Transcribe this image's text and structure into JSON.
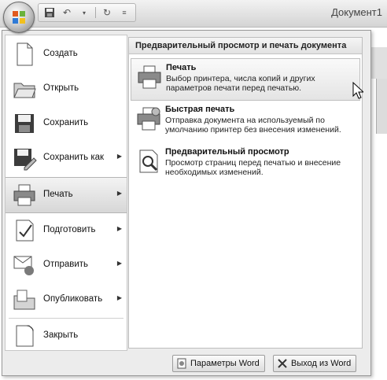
{
  "window": {
    "document_title": "Документ1"
  },
  "quick_access": {
    "save_icon": "floppy-icon",
    "undo_icon": "undo-icon",
    "redo_icon": "redo-icon",
    "customize_icon": "dropdown-icon"
  },
  "left_menu": [
    {
      "label": "Создать",
      "icon": "new-document-icon",
      "has_submenu": false
    },
    {
      "label": "Открыть",
      "icon": "open-folder-icon",
      "has_submenu": false
    },
    {
      "label": "Сохранить",
      "icon": "floppy-icon",
      "has_submenu": false
    },
    {
      "label": "Сохранить как",
      "icon": "save-as-icon",
      "has_submenu": true
    },
    {
      "label": "Печать",
      "icon": "printer-icon",
      "has_submenu": true
    },
    {
      "label": "Подготовить",
      "icon": "prepare-icon",
      "has_submenu": true
    },
    {
      "label": "Отправить",
      "icon": "send-icon",
      "has_submenu": true
    },
    {
      "label": "Опубликовать",
      "icon": "publish-icon",
      "has_submenu": true
    },
    {
      "label": "Закрыть",
      "icon": "close-document-icon",
      "has_submenu": false
    }
  ],
  "submenu": {
    "header": "Предварительный просмотр и печать документа",
    "items": [
      {
        "title": "Печать",
        "description": "Выбор принтера, числа копий и других параметров печати перед печатью."
      },
      {
        "title": "Быстрая печать",
        "description": "Отправка документа на используемый по умолчанию принтер без внесения изменений."
      },
      {
        "title": "Предварительный просмотр",
        "description": "Просмотр страниц перед печатью и внесение необходимых изменений."
      }
    ]
  },
  "footer": {
    "options_label": "Параметры Word",
    "exit_label": "Выход из Word"
  }
}
